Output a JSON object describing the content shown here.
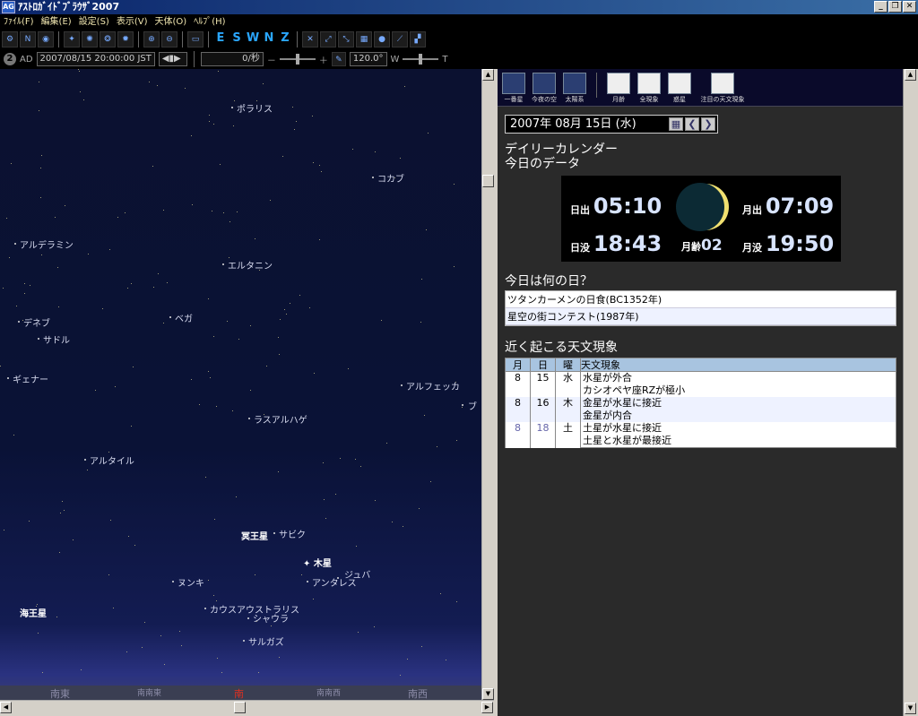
{
  "window": {
    "title": "ｱｽﾄﾛｶﾞｲﾄﾞﾌﾞﾗｳｻﾞ2007",
    "icon": "AG"
  },
  "menu": [
    "ﾌｧｲﾙ(F)",
    "編集(E)",
    "設定(S)",
    "表示(V)",
    "天体(O)",
    "ﾍﾙﾌﾟ(H)"
  ],
  "directions": [
    "E",
    "S",
    "W",
    "N",
    "Z"
  ],
  "status": {
    "mode": "2",
    "era": "AD",
    "datetime": "2007/08/15 20:00:00 JST",
    "speed": "0/秒",
    "fov": "120.0°",
    "w": "W",
    "t": "T"
  },
  "sky": {
    "stars": [
      {
        "name": "ポラリス"
      },
      {
        "name": "コカブ"
      },
      {
        "name": "アルデラミン"
      },
      {
        "name": "エルタニン"
      },
      {
        "name": "ベガ"
      },
      {
        "name": "デネブ"
      },
      {
        "name": "サドル"
      },
      {
        "name": "ギェナー"
      },
      {
        "name": "アルフェッカ"
      },
      {
        "name": "ラスアルハゲ"
      },
      {
        "name": "アルタイル"
      },
      {
        "name": "サビク"
      },
      {
        "name": "ジュバ"
      },
      {
        "name": "アンタレス"
      },
      {
        "name": "ヌンキ"
      },
      {
        "name": "カウスアウストラリス"
      },
      {
        "name": "シャウラ"
      },
      {
        "name": "サルガズ"
      },
      {
        "name": "ブ"
      }
    ],
    "planets": [
      "冥王星",
      "木星",
      "海王星"
    ],
    "horizon": [
      "南東",
      "南南東",
      "南",
      "南南西",
      "南西"
    ]
  },
  "panel": {
    "buttons": [
      "一番星",
      "今夜の空",
      "太陽系",
      "月齢",
      "全現象",
      "惑星",
      "注目の天文現象"
    ],
    "date": "2007年 08月 15日 (水)",
    "title1": "デイリーカレンダー",
    "title2": "今日のデータ",
    "sunrise_label": "日出",
    "sunrise": "05:10",
    "sunset_label": "日没",
    "sunset": "18:43",
    "moonrise_label": "月出",
    "moonrise": "07:09",
    "moonset_label": "月没",
    "moonset": "19:50",
    "moonage_label": "月齢",
    "moonage": "02",
    "whatday_title": "今日は何の日？",
    "whatday": [
      "ツタンカーメンの日食(BC1352年)",
      "星空の街コンテスト(1987年)"
    ],
    "events_title": "近く起こる天文現象",
    "events_headers": [
      "月",
      "日",
      "曜",
      "天文現象"
    ],
    "events": [
      {
        "m": "8",
        "d": "15",
        "w": "水",
        "text": "水星が外合"
      },
      {
        "m": "",
        "d": "",
        "w": "",
        "text": "カシオペヤ座RZが極小"
      },
      {
        "m": "8",
        "d": "16",
        "w": "木",
        "text": "金星が水星に接近"
      },
      {
        "m": "",
        "d": "",
        "w": "",
        "text": "金星が内合"
      },
      {
        "m": "8",
        "d": "18",
        "w": "土",
        "text": "土星が水星に接近"
      },
      {
        "m": "",
        "d": "",
        "w": "",
        "text": "土星と水星が最接近"
      }
    ]
  }
}
